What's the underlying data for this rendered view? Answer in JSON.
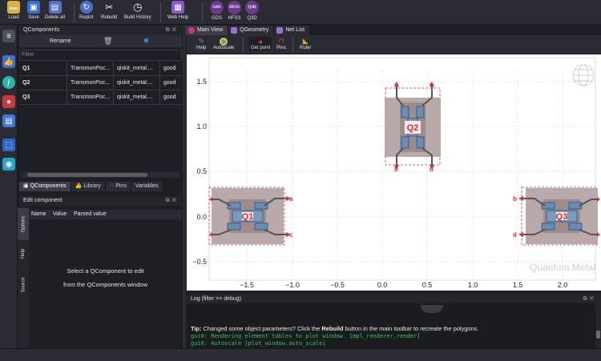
{
  "toolbar": {
    "buttons": [
      {
        "label": "Load",
        "icon": "folder-icon"
      },
      {
        "label": "Save",
        "icon": "save-icon"
      },
      {
        "label": "Delete all",
        "icon": "delete-all-icon"
      },
      {
        "label": "Replot",
        "icon": "replot-icon"
      },
      {
        "label": "Rebuild",
        "icon": "rebuild-icon"
      },
      {
        "label": "Build History",
        "icon": "history-icon"
      },
      {
        "label": "Web Help",
        "icon": "web-help-icon"
      },
      {
        "label": "GDS",
        "icon_text": "GDS"
      },
      {
        "label": "HFSS",
        "icon_text": "HFSS"
      },
      {
        "label": "Q3D",
        "icon_text": "Q3D"
      }
    ]
  },
  "qcomponents_panel": {
    "title": "QComponents",
    "rename_label": "Rename",
    "filter_placeholder": "Filter",
    "rows": [
      {
        "name": "Q1",
        "class": "TransmonPoc...",
        "module": "qiskit_metal....",
        "status": "good"
      },
      {
        "name": "Q2",
        "class": "TransmonPoc...",
        "module": "qiskit_metal....",
        "status": "good"
      },
      {
        "name": "Q3",
        "class": "TransmonPoc...",
        "module": "qiskit_metal....",
        "status": "good"
      }
    ],
    "tabs": [
      "QComponents",
      "Library",
      "Pins",
      "Variables"
    ]
  },
  "edit_panel": {
    "title": "Edit component",
    "columns": [
      "Name",
      "Value",
      "Parsed value"
    ],
    "message_line1": "Select a QComponent to edit",
    "message_line2": "from the QComponents window",
    "vertical_tabs": [
      "Options",
      "Help",
      "Source"
    ]
  },
  "main_tabs": [
    "Main View",
    "QGeometry",
    "Net List"
  ],
  "plot_toolbar": [
    "Help",
    "Autoscale",
    "Get point",
    "Pins",
    "Ruler"
  ],
  "plot": {
    "watermark": "Quantum Metal",
    "x_ticks": [
      "−1.5",
      "−1.0",
      "−0.5",
      "0.0",
      "0.5",
      "1.0",
      "1.5",
      "2.0"
    ],
    "y_ticks": [
      "1.5",
      "1.0",
      "0.5",
      "0.0",
      "−0.5"
    ],
    "components": [
      {
        "name": "Q1",
        "pins": [
          "a",
          "c"
        ]
      },
      {
        "name": "Q2",
        "pins": [
          "a",
          "c",
          "b",
          "d"
        ]
      },
      {
        "name": "Q3",
        "pins": [
          "b",
          "d"
        ]
      }
    ]
  },
  "log": {
    "title": "Log  (filter >= debug)",
    "tip_prefix": "Tip:",
    "tip_text_1": " Changed some object parameters? Click the ",
    "tip_bold": "Rebuild",
    "tip_text_2": " button in the main toolbar to recreate the polygons.",
    "lines": [
      "gui0: Rendering element tables to plot window. [mpl_renderer.render]",
      "gui0: Autoscale [plot_window.auto_scale]"
    ]
  },
  "colors": {
    "accent_purple": "#6b3a8c",
    "log_green": "#34c759",
    "pin_red": "#d93030"
  }
}
